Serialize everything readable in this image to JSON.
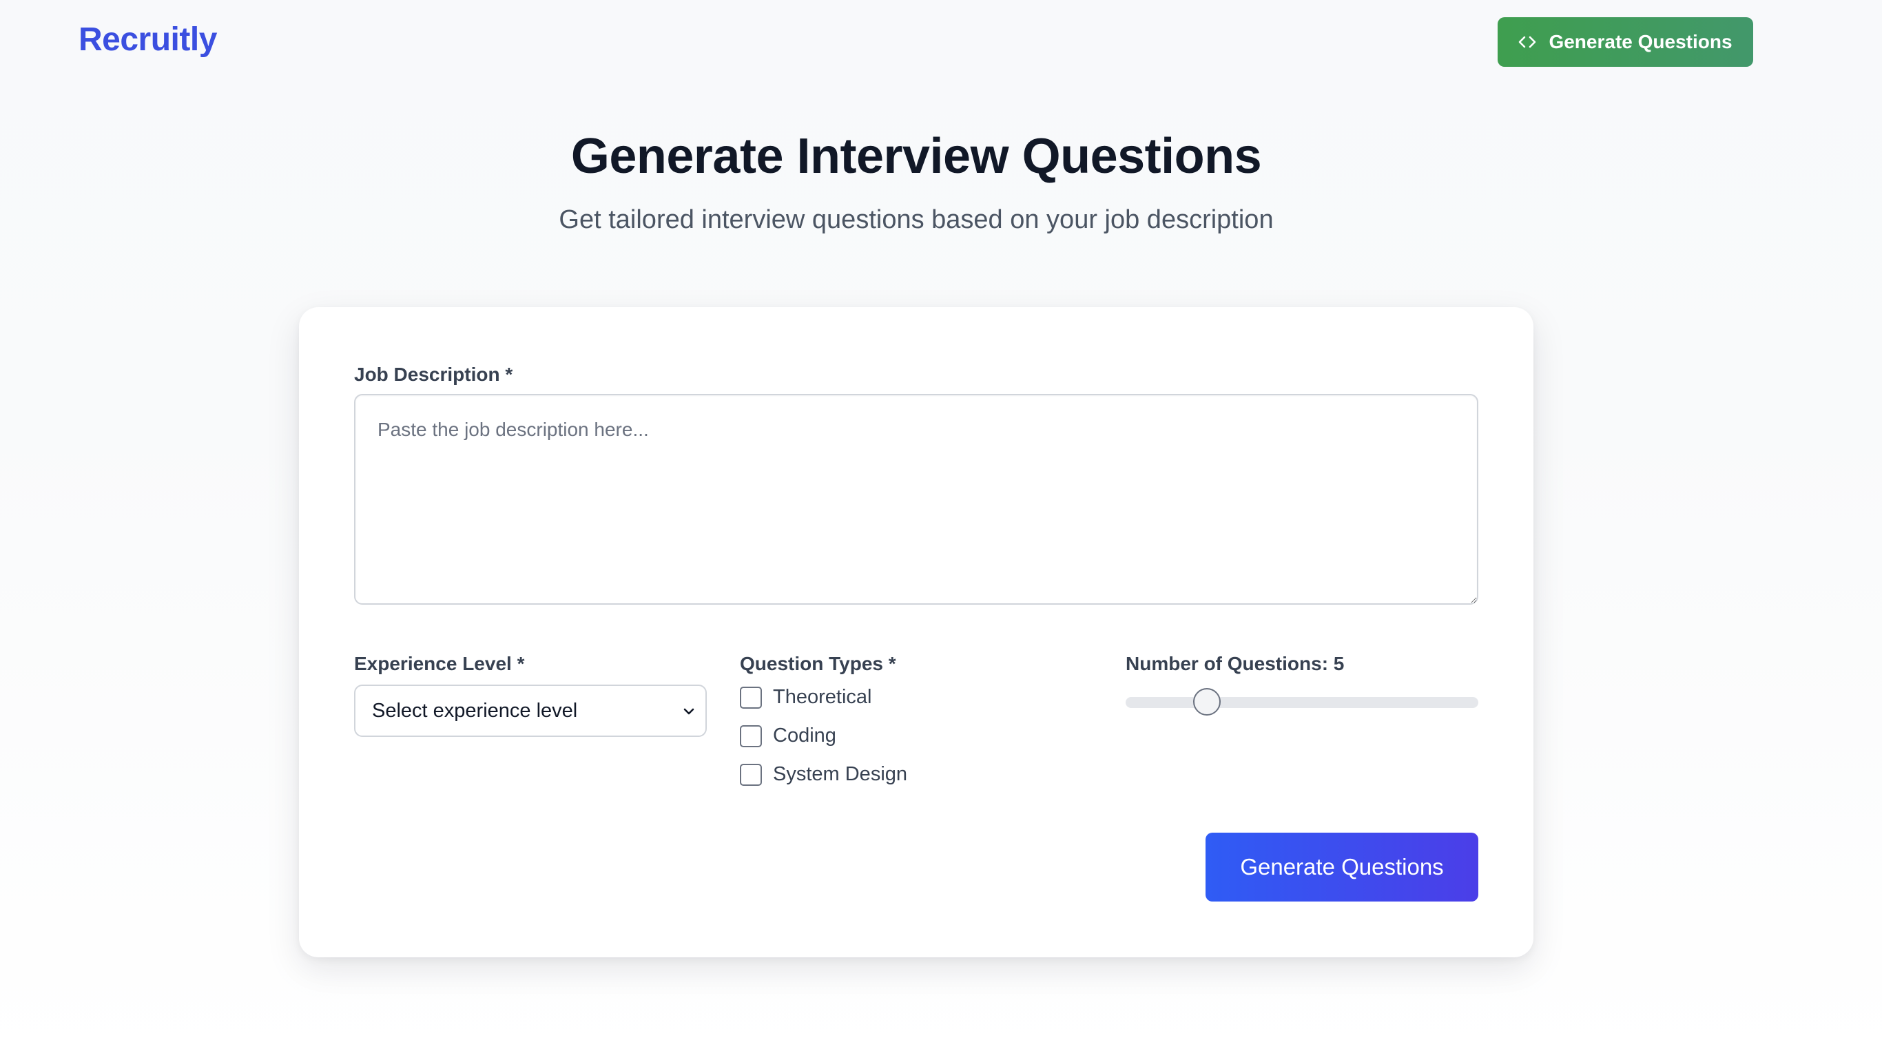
{
  "header": {
    "logo": "Recruitly",
    "action_button_label": "Generate Questions",
    "action_button_icon": "code-icon"
  },
  "hero": {
    "title": "Generate Interview Questions",
    "subtitle": "Get tailored interview questions based on your job description"
  },
  "form": {
    "job_description": {
      "label": "Job Description *",
      "value": "",
      "placeholder": "Paste the job description here..."
    },
    "experience_level": {
      "label": "Experience Level *",
      "selected": "Select experience level"
    },
    "question_types": {
      "label": "Question Types *",
      "options": [
        {
          "label": "Theoretical",
          "checked": false
        },
        {
          "label": "Coding",
          "checked": false
        },
        {
          "label": "System Design",
          "checked": false
        }
      ]
    },
    "number_of_questions": {
      "label": "Number of Questions: 5",
      "value": 5,
      "slider_fraction": 0.23
    },
    "submit_label": "Generate Questions"
  },
  "colors": {
    "brand": "#3b4fe0",
    "header_button": "#3f9e4f",
    "submit_button_start": "#2f5cf5",
    "submit_button_end": "#4b3ee8"
  }
}
